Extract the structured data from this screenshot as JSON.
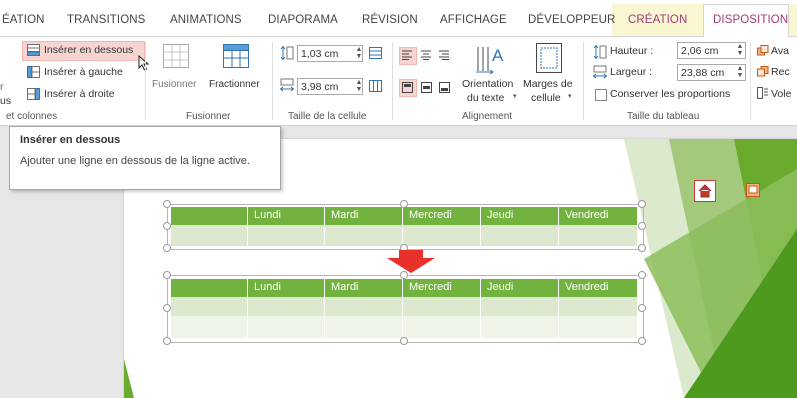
{
  "tabs": {
    "t1": "ÉATION",
    "t2": "TRANSITIONS",
    "t3": "ANIMATIONS",
    "t4": "DIAPORAMA",
    "t5": "RÉVISION",
    "t6": "AFFICHAGE",
    "t7": "DÉVELOPPEUR",
    "t8": "CRÉATION",
    "t9": "DISPOSITION"
  },
  "rows_cols": {
    "insert_below": "Insérer en dessous",
    "insert_left": "Insérer à gauche",
    "insert_right": "Insérer à droite",
    "partial_r": "r",
    "partial_us": "us",
    "group_label": "et colonnes"
  },
  "merge": {
    "merge_label": "Fusionner",
    "split_label": "Fractionner",
    "group_label": "Fusionner"
  },
  "cell_size": {
    "height_value": "1,03 cm",
    "width_value": "3,98 cm",
    "group_label": "Taille de la cellule"
  },
  "alignment": {
    "orientation_line1": "Orientation",
    "orientation_line2": "du texte",
    "margins_line1": "Marges de",
    "margins_line2": "cellule",
    "group_label": "Alignement"
  },
  "table_size": {
    "height_label": "Hauteur :",
    "height_value": "2,06 cm",
    "width_label": "Largeur :",
    "width_value": "23,88 cm",
    "lock_label": "Conserver les proportions",
    "group_label": "Taille du tableau"
  },
  "arrange": {
    "forward": "Ava",
    "backward": "Rec",
    "pane": "Vole"
  },
  "tooltip": {
    "title": "Insérer en dessous",
    "body": "Ajouter une ligne en dessous de la ligne active."
  },
  "table_headers": [
    "",
    "Lundi",
    "Mardi",
    "Mercredi",
    "Jeudi",
    "Vendredi"
  ],
  "colors": {
    "header_green": "#72b23e",
    "row_light": "#dce9cf",
    "ctx_tab_bg": "#faf6d2",
    "ctx_tab_text": "#a03c78",
    "arrow_red": "#e8312a"
  }
}
